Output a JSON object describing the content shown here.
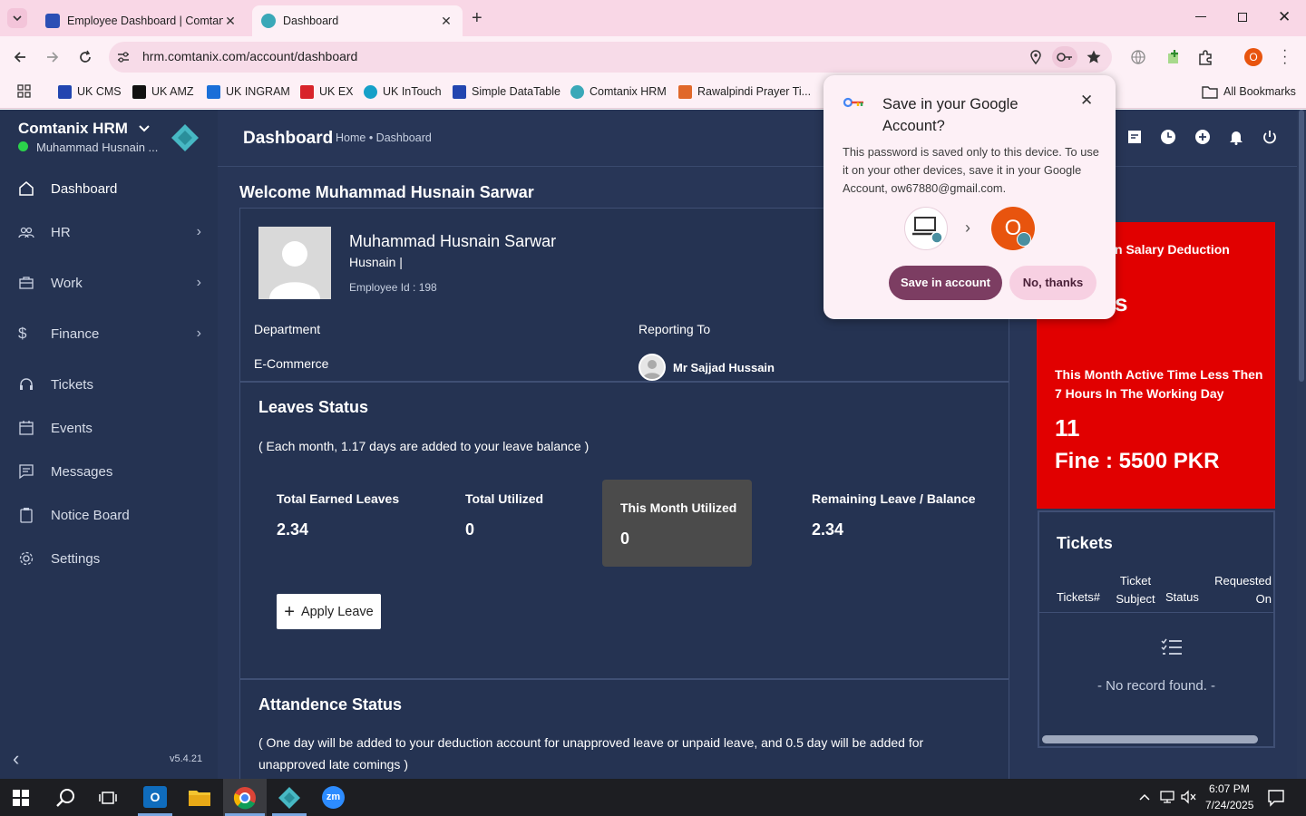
{
  "browser": {
    "tabs": [
      {
        "title": "Employee Dashboard | Comtanix",
        "favicon_color": "#2b4fb5"
      },
      {
        "title": "Dashboard",
        "favicon_color": "#3aa8b8"
      }
    ],
    "url": "hrm.comtanix.com/account/dashboard",
    "profile_initial": "O",
    "bookmarks": [
      {
        "label": "UK CMS",
        "icon_color": "#2246b0"
      },
      {
        "label": "UK AMZ",
        "icon_color": "#111111"
      },
      {
        "label": "UK INGRAM",
        "icon_color": "#1a6fd8"
      },
      {
        "label": "UK EX",
        "icon_color": "#d8232a"
      },
      {
        "label": "UK InTouch",
        "icon_color": "#16a0c8"
      },
      {
        "label": "Simple DataTable",
        "icon_color": "#2246b0"
      },
      {
        "label": "Comtanix HRM",
        "icon_color": "#3aa8b8"
      },
      {
        "label": "Rawalpindi Prayer Ti...",
        "icon_color": "#e0682a"
      }
    ],
    "all_bookmarks_label": "All Bookmarks"
  },
  "password_popup": {
    "title": "Save in your Google Account?",
    "body": "This password is saved only to this device. To use it on your other devices, save it in your Google Account, ow67880@gmail.com.",
    "avatar_initial": "O",
    "save_label": "Save in account",
    "decline_label": "No, thanks"
  },
  "sidebar": {
    "brand": "Comtanix HRM",
    "user": "Muhammad Husnain ...",
    "version": "v5.4.21",
    "items": [
      {
        "label": "Dashboard",
        "icon": "home-icon",
        "has_submenu": false
      },
      {
        "label": "HR",
        "icon": "users-icon",
        "has_submenu": true
      },
      {
        "label": "Work",
        "icon": "briefcase-icon",
        "has_submenu": true
      },
      {
        "label": "Finance",
        "icon": "dollar-icon",
        "has_submenu": true
      },
      {
        "label": "Tickets",
        "icon": "headset-icon",
        "has_submenu": false
      },
      {
        "label": "Events",
        "icon": "calendar-icon",
        "has_submenu": false
      },
      {
        "label": "Messages",
        "icon": "message-icon",
        "has_submenu": false
      },
      {
        "label": "Notice Board",
        "icon": "clipboard-icon",
        "has_submenu": false
      },
      {
        "label": "Settings",
        "icon": "gear-icon",
        "has_submenu": false
      }
    ]
  },
  "header": {
    "title": "Dashboard",
    "breadcrumb": "Home • Dashboard"
  },
  "welcome": "Welcome Muhammad Husnain Sarwar",
  "profile": {
    "name": "Muhammad Husnain Sarwar",
    "short_name": "Husnain |",
    "employee_id": "Employee Id : 198",
    "department_label": "Department",
    "department": "E-Commerce",
    "reporting_label": "Reporting To",
    "reporting_to": "Mr Sajjad Hussain"
  },
  "leaves": {
    "title": "Leaves Status",
    "note": "( Each month, 1.17 days are added to your leave balance )",
    "stats": [
      {
        "label": "Total Earned Leaves",
        "value": "2.34"
      },
      {
        "label": "Total Utilized",
        "value": "0"
      },
      {
        "label": "This Month Utilized",
        "value": "0"
      },
      {
        "label": "Remaining Leave / Balance",
        "value": "2.34"
      }
    ],
    "apply_label": "Apply Leave"
  },
  "attendance": {
    "title": "Attandence Status",
    "note": "( One day will be added to your deduction account for unapproved leave or unpaid leave, and 0.5 day will be added for unapproved late comings )"
  },
  "salary_card": {
    "title_fragment": "n Salary Deduction",
    "big_fragment": "s",
    "warning": "This Month Active Time Less Then 7 Hours In The Working Day",
    "count": "11",
    "fine": "Fine : 5500 PKR",
    "color": "#e10000"
  },
  "tickets": {
    "title": "Tickets",
    "columns": [
      "Tickets#",
      "Ticket Subject",
      "Status",
      "Requested On"
    ],
    "empty": "- No record found. -"
  },
  "taskbar": {
    "time": "6:07 PM",
    "date": "7/24/2025"
  }
}
